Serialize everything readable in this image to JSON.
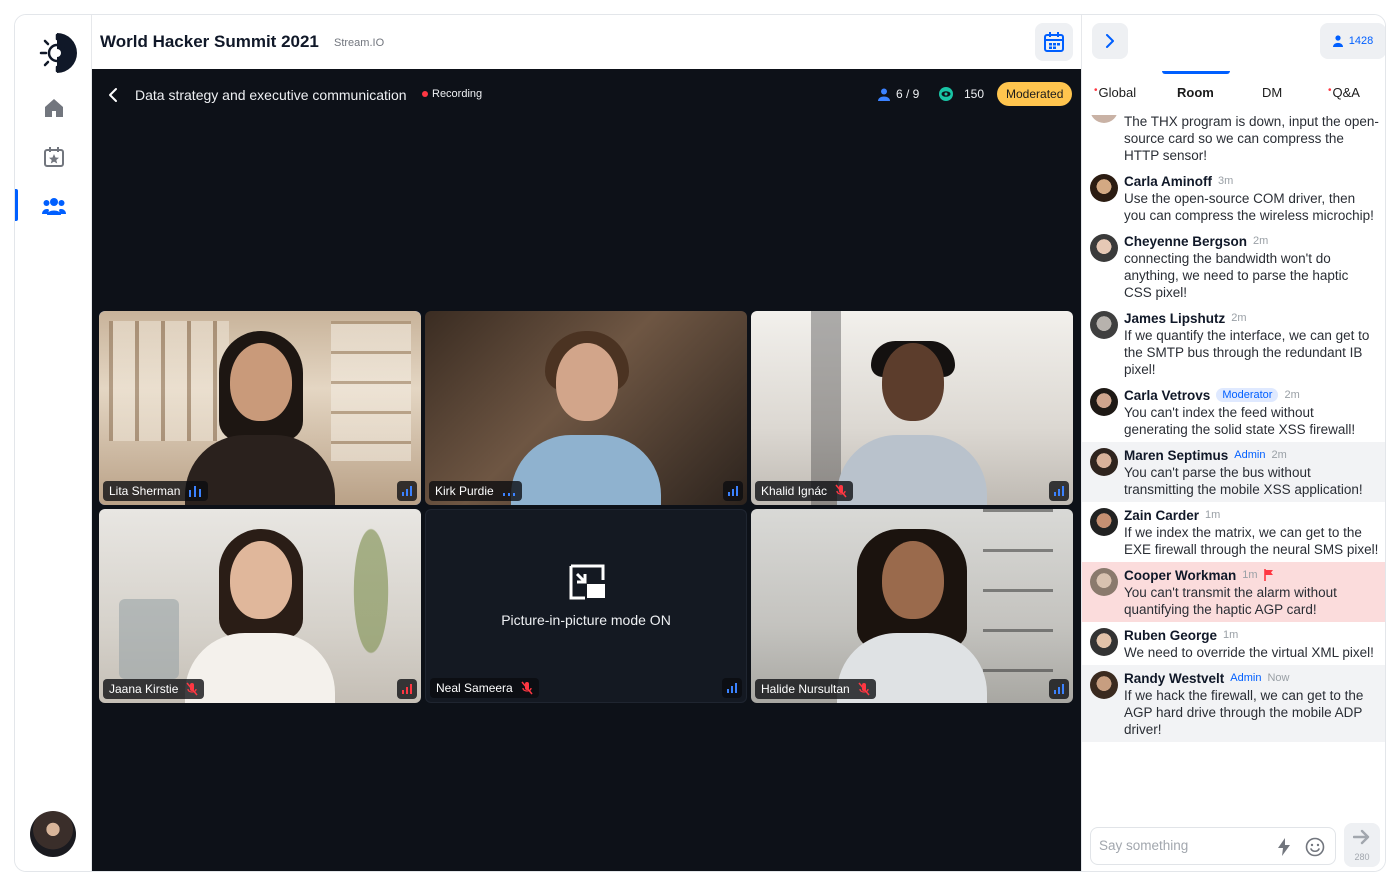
{
  "header": {
    "title": "World Hacker Summit 2021",
    "org": "Stream.IO"
  },
  "sidebar": {
    "items": [
      "home-icon",
      "calendar-star-icon",
      "users-icon"
    ],
    "active": 2
  },
  "stage": {
    "room_title": "Data strategy and executive communication",
    "recording_label": "Recording",
    "participants": "6 / 9",
    "viewers": "150",
    "moderated_label": "Moderated",
    "pip_text": "Picture-in-picture mode ON",
    "tiles": [
      {
        "name": "Lita Sherman",
        "mic": "talking",
        "active": true
      },
      {
        "name": "Kirk Purdie",
        "mic": "on"
      },
      {
        "name": "Khalid Ignác",
        "mic": "muted"
      },
      {
        "name": "Jaana Kirstie",
        "mic": "muted"
      },
      {
        "name": "Neal Sameera",
        "mic": "muted",
        "pip": true
      },
      {
        "name": "Halide Nursultan",
        "mic": "muted"
      }
    ]
  },
  "chat": {
    "viewer_count": "1428",
    "tabs": [
      "Global",
      "Room",
      "DM",
      "Q&A"
    ],
    "active_tab": "Room",
    "messages": [
      {
        "name": "",
        "role": "",
        "time": "",
        "text": "The THX program is down, input the open-source card so we can compress the HTTP sensor!"
      },
      {
        "name": "Carla Aminoff",
        "role": "",
        "time": "3m",
        "text": "Use the open-source COM driver, then you can compress the wireless microchip!"
      },
      {
        "name": "Cheyenne Bergson",
        "role": "",
        "time": "2m",
        "text": "connecting the bandwidth won't do anything, we need to parse the haptic CSS pixel!"
      },
      {
        "name": "James Lipshutz",
        "role": "",
        "time": "2m",
        "text": "If we quantify the interface, we can get to the SMTP bus through the redundant IB pixel!"
      },
      {
        "name": "Carla Vetrovs",
        "role": "Moderator",
        "time": "2m",
        "text": "You can't index the feed without generating the solid state XSS firewall!"
      },
      {
        "name": "Maren Septimus",
        "role": "Admin",
        "time": "2m",
        "text": "You can't parse the bus without transmitting the mobile XSS application!",
        "shade": true
      },
      {
        "name": "Zain Carder",
        "role": "",
        "time": "1m",
        "text": "If we index the matrix, we can get to the EXE firewall through the neural SMS pixel!"
      },
      {
        "name": "Cooper Workman",
        "role": "",
        "time": "1m",
        "text": "You can't transmit the alarm without quantifying the haptic AGP card!",
        "flagged": true
      },
      {
        "name": "Ruben George",
        "role": "",
        "time": "1m",
        "text": "We need to override the virtual XML pixel!"
      },
      {
        "name": "Randy Westvelt",
        "role": "Admin",
        "time": "Now",
        "text": "If we hack the firewall, we can get to the AGP hard drive through the mobile ADP driver!",
        "shade": true
      }
    ],
    "composer": {
      "placeholder": "Say something",
      "char_limit": "280"
    }
  },
  "colors": {
    "accent": "#005fff",
    "moderated": "#ffc54e",
    "recording": "#ff3742",
    "stage": "#0d1118"
  }
}
